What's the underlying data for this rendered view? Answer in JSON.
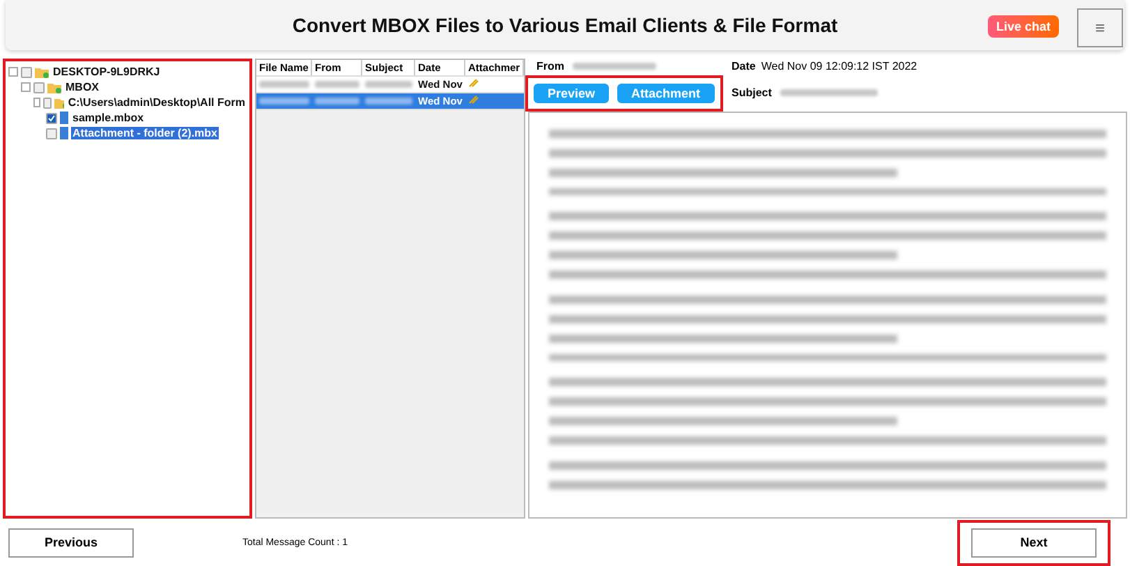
{
  "header": {
    "title": "Convert MBOX Files to Various Email Clients & File Format",
    "live_chat": "Live chat",
    "menu": "≡"
  },
  "tree": {
    "highlighted": true,
    "items": [
      {
        "label": "DESKTOP-9L9DRKJ",
        "checked": false,
        "selected": false,
        "kind": "folder",
        "children": [
          {
            "label": "MBOX",
            "checked": false,
            "selected": false,
            "kind": "folder",
            "children": [
              {
                "label": "C:\\Users\\admin\\Desktop\\All Form",
                "checked": false,
                "selected": false,
                "kind": "folder",
                "children": [
                  {
                    "label": "sample.mbox",
                    "checked": true,
                    "selected": false,
                    "kind": "file"
                  },
                  {
                    "label": "Attachment - folder (2).mbx",
                    "checked": false,
                    "selected": true,
                    "kind": "file"
                  }
                ]
              }
            ]
          }
        ]
      }
    ]
  },
  "table": {
    "columns": [
      "File Name",
      "From",
      "Subject",
      "Date",
      "Attachmer"
    ],
    "rows": [
      {
        "date": "Wed Nov",
        "selected": false
      },
      {
        "date": "Wed Nov",
        "selected": true
      }
    ]
  },
  "preview": {
    "from_label": "From",
    "date_label": "Date",
    "date": "Wed Nov 09 12:09:12 IST 2022",
    "subject_label": "Subject",
    "buttons_highlighted": true,
    "buttons": [
      {
        "label": "Preview"
      },
      {
        "label": "Attachment"
      }
    ]
  },
  "footer": {
    "previous": "Previous",
    "count": "Total Message Count : 1",
    "next": "Next",
    "next_highlighted": true
  }
}
